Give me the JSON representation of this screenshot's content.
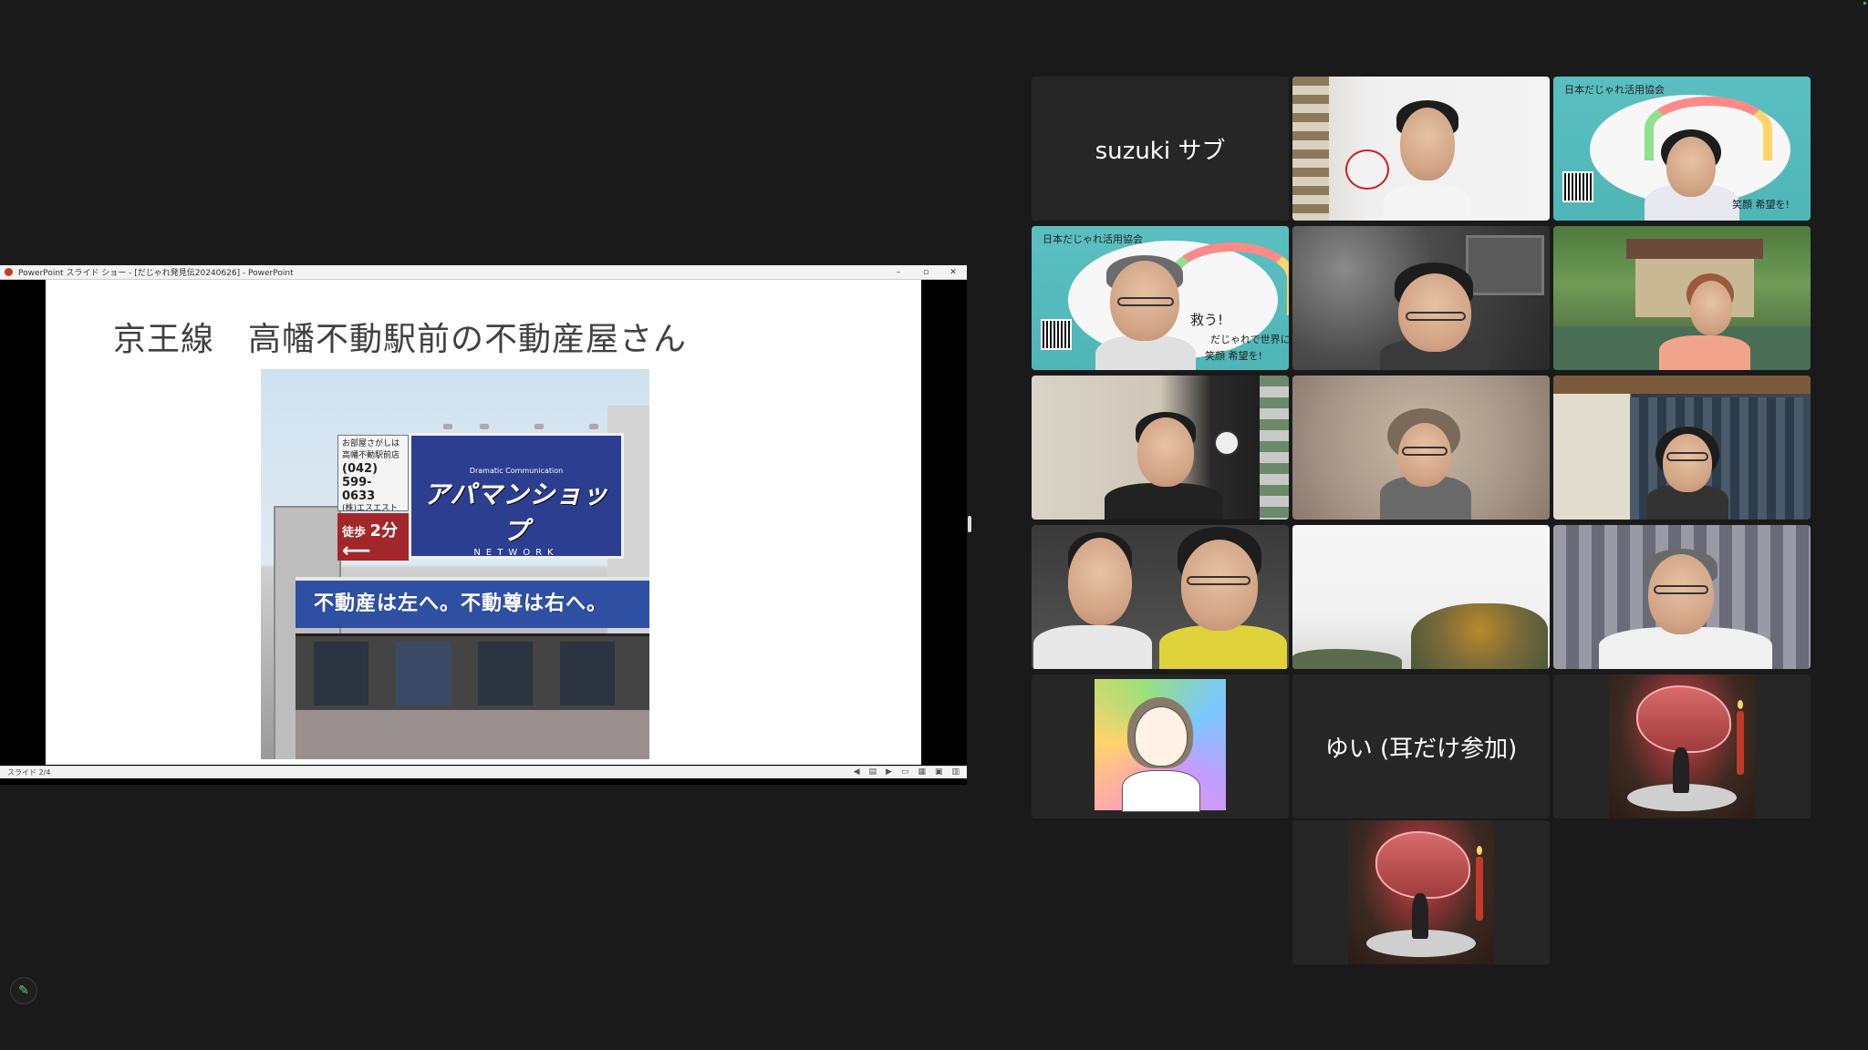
{
  "share": {
    "window_title": "PowerPoint スライド ショー - [だじゃれ発見伝20240626] - PowerPoint",
    "controls": {
      "minimize": "–",
      "restore": "▫",
      "close": "✕"
    },
    "slide": {
      "title": "京王線　高幡不動駅前の不動産屋さん",
      "sign": {
        "info_line1": "お部屋さがしは",
        "info_line2": "高幡不動駅前店",
        "phone_area": "(042)",
        "phone_number": "599-0633",
        "company": "(株)エスエストラスト",
        "walk_label": "徒歩",
        "walk_minutes": "2分",
        "walk_arrow": "⟵",
        "main_sub": "Dramatic Communication",
        "main_brand": "アパマンショップ",
        "main_net": "NETWORK",
        "bottom_text": "不動産は左へ。不動尊は右へ。"
      }
    },
    "status": {
      "slide_counter": "スライド 2/4"
    }
  },
  "gallery": {
    "participants": [
      {
        "id": "suzuki",
        "label": "suzuki サブ",
        "video": false
      },
      {
        "id": "p2",
        "video": true
      },
      {
        "id": "p3",
        "video": true,
        "banner_title": "日本だじゃれ活用協会",
        "banner_line": "笑顔 希望を!"
      },
      {
        "id": "p4",
        "video": true,
        "active_speaker": true,
        "banner_title": "日本だじゃれ活用協会",
        "banner_slogan": "救う!",
        "banner_line1": "だじゃれで世界に",
        "banner_line2": "笑顔 希望を!"
      },
      {
        "id": "p5",
        "video": true
      },
      {
        "id": "p6",
        "video": true
      },
      {
        "id": "p7",
        "video": true
      },
      {
        "id": "p8",
        "video": true
      },
      {
        "id": "p9",
        "video": true
      },
      {
        "id": "p10",
        "video": true
      },
      {
        "id": "p11",
        "video": true
      },
      {
        "id": "p12",
        "video": true
      },
      {
        "id": "p13",
        "video": false,
        "avatar": "illustrated-avatar"
      },
      {
        "id": "yui",
        "label": "ゆい (耳だけ参加)",
        "video": false
      },
      {
        "id": "p15",
        "video": false,
        "avatar": "steak-photo"
      },
      {
        "id": "p16",
        "video": false,
        "avatar": "steak-photo"
      }
    ]
  },
  "colors": {
    "background": "#1a1a1a",
    "tile": "#262626",
    "active_speaker": "#2dbd4e",
    "sign_blue": "#2c3e8f",
    "sign_red": "#a3262a",
    "banner_teal": "#5bbfc0"
  },
  "toolbar": {
    "annotate_icon": "pencil-icon"
  }
}
